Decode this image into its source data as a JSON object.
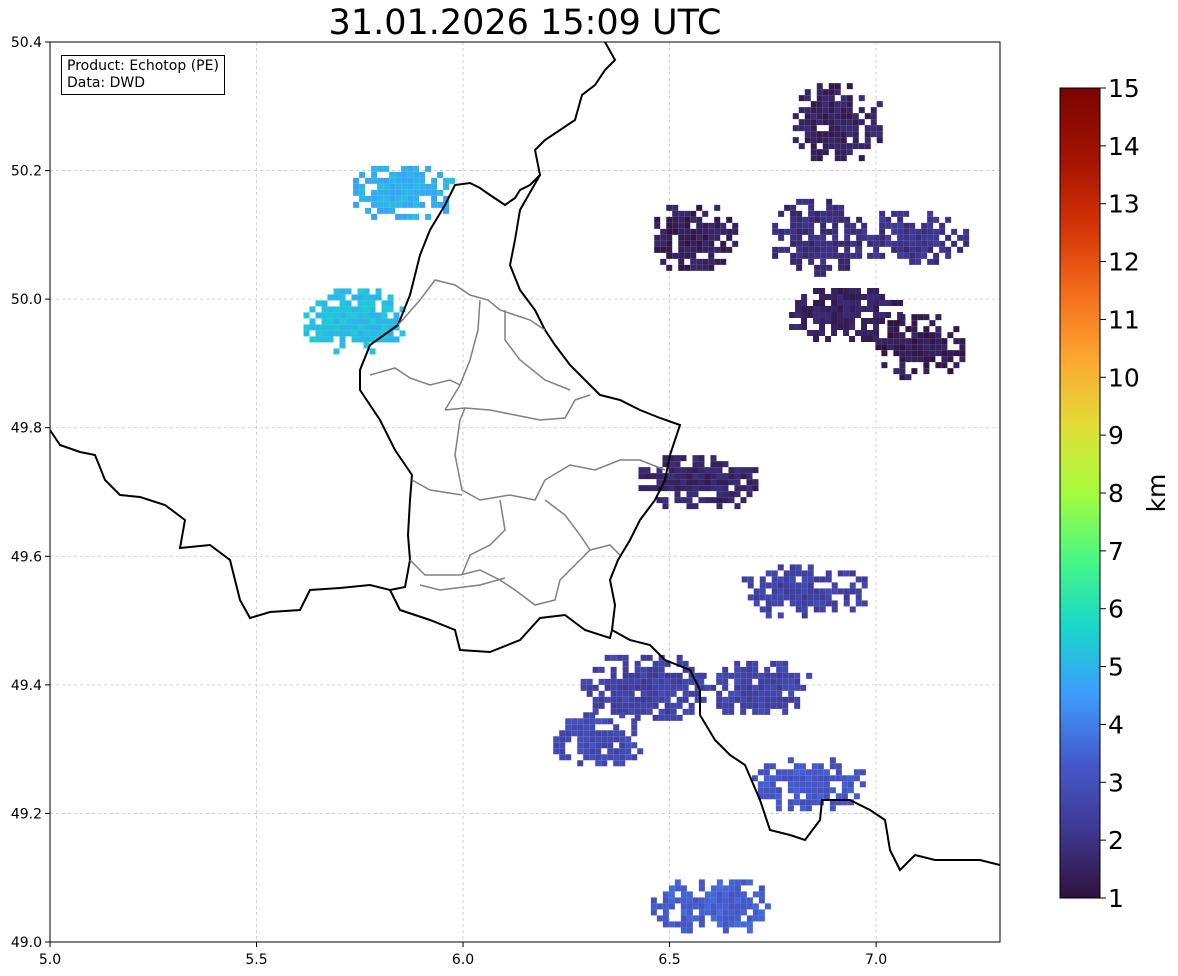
{
  "title": "31.01.2026 15:09 UTC",
  "info": {
    "product": "Product: Echotop (PE)",
    "source": "Data: DWD"
  },
  "map": {
    "lon_range": [
      5.0,
      7.3
    ],
    "lat_range": [
      49.0,
      50.4
    ],
    "x_ticks": [
      "5.0",
      "5.5",
      "6.0",
      "6.5",
      "7.0"
    ],
    "y_ticks": [
      "49.0",
      "49.2",
      "49.4",
      "49.6",
      "49.8",
      "50.0",
      "50.2",
      "50.4"
    ],
    "grid": true,
    "border_color": "#000000",
    "admin_border_color": "#808080",
    "grid_color": "#c8c8c8"
  },
  "colorbar": {
    "label": "km",
    "ticks": [
      "1",
      "2",
      "3",
      "4",
      "5",
      "6",
      "7",
      "8",
      "9",
      "10",
      "11",
      "12",
      "13",
      "14",
      "15"
    ],
    "colormap": "turbo",
    "colors": [
      "#30123b",
      "#3e3891",
      "#4559cb",
      "#3e9bfe",
      "#18d6cb",
      "#46f884",
      "#a4fc3c",
      "#e1dd37",
      "#fea632",
      "#f26b1a",
      "#d23105",
      "#a11201",
      "#7a0403"
    ]
  },
  "echo_cells": [
    {
      "lon": 6.9,
      "lat": 50.28,
      "value_km": 1.5
    },
    {
      "lon": 6.85,
      "lat": 50.1,
      "value_km": 1.8
    },
    {
      "lon": 7.08,
      "lat": 50.1,
      "value_km": 2.0
    },
    {
      "lon": 6.55,
      "lat": 50.1,
      "value_km": 1.4
    },
    {
      "lon": 6.92,
      "lat": 49.98,
      "value_km": 1.5
    },
    {
      "lon": 7.1,
      "lat": 49.93,
      "value_km": 1.3
    },
    {
      "lon": 6.57,
      "lat": 49.72,
      "value_km": 1.6
    },
    {
      "lon": 6.82,
      "lat": 49.55,
      "value_km": 2.5
    },
    {
      "lon": 6.43,
      "lat": 49.4,
      "value_km": 2.5
    },
    {
      "lon": 6.7,
      "lat": 49.4,
      "value_km": 2.6
    },
    {
      "lon": 6.32,
      "lat": 49.32,
      "value_km": 2.8
    },
    {
      "lon": 6.83,
      "lat": 49.25,
      "value_km": 3.2
    },
    {
      "lon": 6.6,
      "lat": 49.06,
      "value_km": 3.4
    },
    {
      "lon": 5.73,
      "lat": 49.97,
      "value_km": 5.2
    },
    {
      "lon": 5.85,
      "lat": 50.17,
      "value_km": 4.9
    }
  ]
}
